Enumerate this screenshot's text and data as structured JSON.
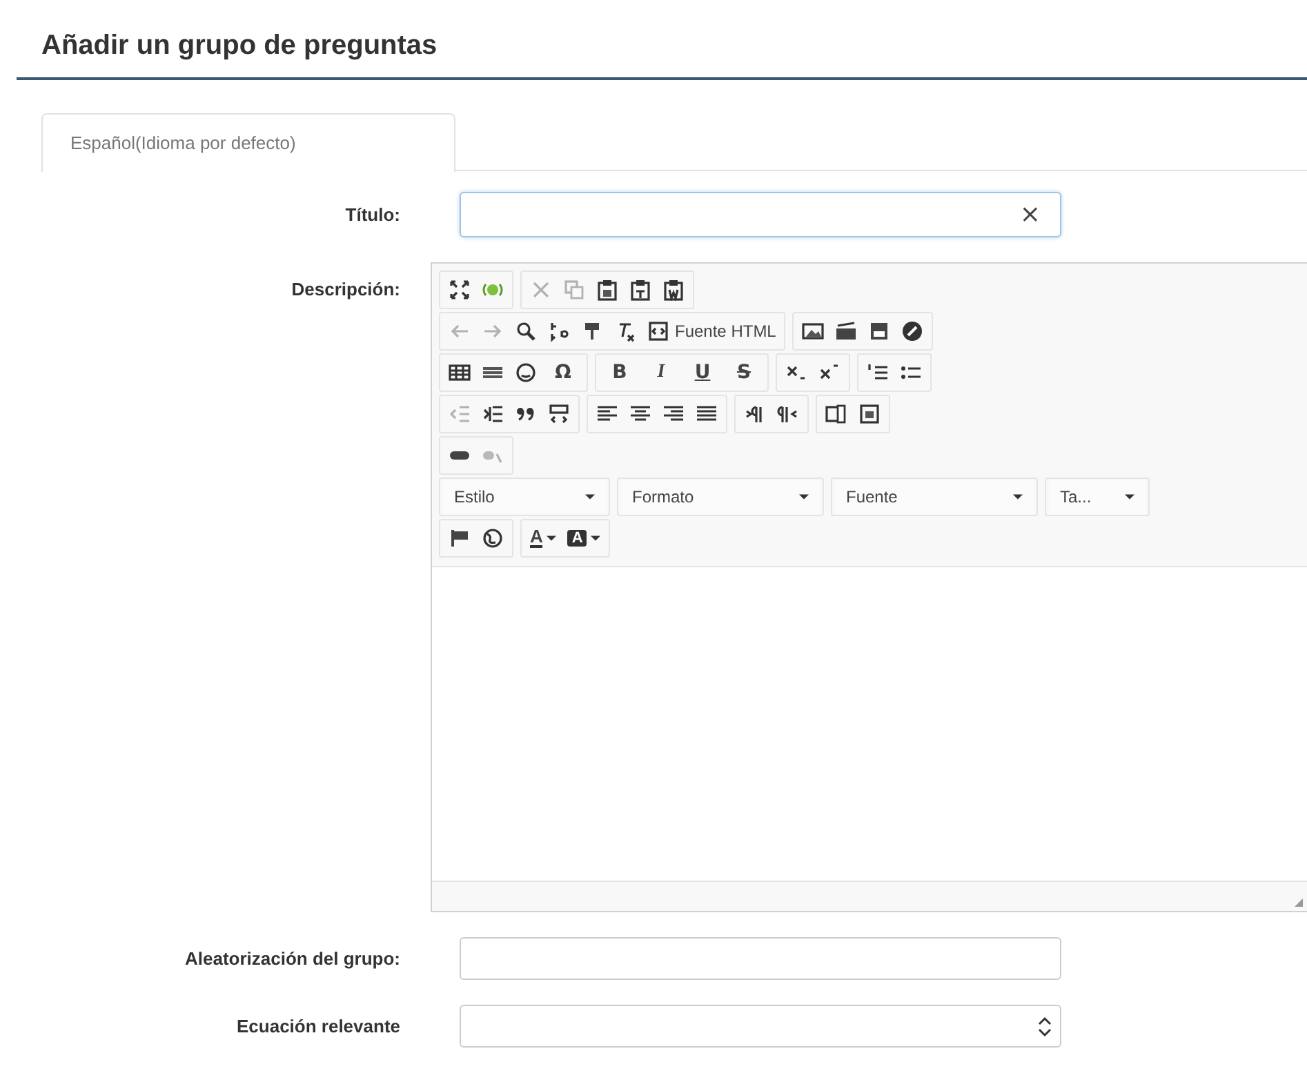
{
  "page_title": "Añadir un grupo de preguntas",
  "tabs": [
    {
      "label": "Español(Idioma por defecto)",
      "selected": true
    }
  ],
  "title_field": {
    "label": "Título:",
    "clear_button": "×"
  },
  "description": {
    "label": "Descripción:",
    "toolbar_rows": [
      {
        "groups": [
          {
            "items": [
              {
                "kind": "icon",
                "disabled": false
              },
              {
                "kind": "icon",
                "disabled": false
              }
            ]
          },
          {
            "items": [
              {
                "kind": "icon",
                "disabled": true
              },
              {
                "kind": "icon",
                "disabled": true
              },
              {
                "kind": "icon",
                "disabled": false
              },
              {
                "kind": "icon",
                "disabled": false
              },
              {
                "kind": "icon",
                "disabled": false
              }
            ]
          }
        ]
      },
      {
        "groups": [
          {
            "items": [
              {
                "kind": "icon",
                "disabled": true
              },
              {
                "kind": "icon",
                "disabled": true
              },
              {
                "kind": "icon",
                "disabled": false
              },
              {
                "kind": "icon",
                "disabled": false
              },
              {
                "kind": "icon",
                "disabled": false
              },
              {
                "kind": "icon",
                "disabled": false
              },
              {
                "kind": "button",
                "label": "Fuente HTML",
                "disabled": false
              }
            ]
          },
          {
            "items": [
              {
                "kind": "icon",
                "disabled": false
              },
              {
                "kind": "icon",
                "disabled": false
              },
              {
                "kind": "icon",
                "disabled": false
              },
              {
                "kind": "icon",
                "disabled": false
              }
            ]
          }
        ]
      },
      {
        "groups": [
          {
            "items": [
              {
                "kind": "icon",
                "disabled": false
              },
              {
                "kind": "icon",
                "disabled": false
              },
              {
                "kind": "icon",
                "disabled": false
              },
              {
                "kind": "glyph",
                "text": "Ω",
                "disabled": false
              }
            ]
          },
          {
            "items": [
              {
                "kind": "glyph",
                "text": "B",
                "disabled": false
              },
              {
                "kind": "glyph",
                "text": "I",
                "disabled": false
              },
              {
                "kind": "glyph",
                "text": "U",
                "disabled": false
              },
              {
                "kind": "glyph",
                "text": "S",
                "disabled": false
              }
            ]
          },
          {
            "items": [
              {
                "kind": "icon",
                "disabled": false
              },
              {
                "kind": "icon",
                "disabled": false
              }
            ]
          },
          {
            "items": [
              {
                "kind": "icon",
                "disabled": false
              },
              {
                "kind": "icon",
                "disabled": false
              }
            ]
          }
        ]
      },
      {
        "groups": [
          {
            "items": [
              {
                "kind": "icon",
                "disabled": true
              },
              {
                "kind": "icon",
                "disabled": false
              },
              {
                "kind": "icon",
                "disabled": false
              },
              {
                "kind": "icon",
                "disabled": false
              }
            ]
          },
          {
            "items": [
              {
                "kind": "icon",
                "disabled": false
              },
              {
                "kind": "icon",
                "disabled": false
              },
              {
                "kind": "icon",
                "disabled": false
              },
              {
                "kind": "icon",
                "disabled": false
              }
            ]
          },
          {
            "items": [
              {
                "kind": "icon",
                "disabled": false
              },
              {
                "kind": "icon",
                "disabled": false
              }
            ]
          },
          {
            "items": [
              {
                "kind": "icon",
                "disabled": false
              },
              {
                "kind": "icon",
                "disabled": false
              }
            ]
          }
        ]
      },
      {
        "groups": [
          {
            "items": [
              {
                "kind": "icon",
                "disabled": false
              },
              {
                "kind": "icon",
                "disabled": true
              }
            ]
          }
        ]
      },
      {
        "groups": [
          {
            "items": [
              {
                "kind": "dropdown",
                "label": "Estilo",
                "disabled": false
              }
            ]
          },
          {
            "items": [
              {
                "kind": "dropdown",
                "label": "Formato",
                "disabled": false
              }
            ]
          },
          {
            "items": [
              {
                "kind": "dropdown",
                "label": "Fuente",
                "disabled": false
              }
            ]
          },
          {
            "items": [
              {
                "kind": "dropdown",
                "label": "Ta...",
                "disabled": false
              }
            ]
          }
        ]
      },
      {
        "groups": [
          {
            "items": [
              {
                "kind": "icon",
                "disabled": false
              },
              {
                "kind": "icon",
                "disabled": false
              }
            ]
          },
          {
            "items": [
              {
                "kind": "text-color",
                "text": "A",
                "disabled": false
              },
              {
                "kind": "bg-color",
                "text": "A",
                "disabled": false
              }
            ]
          }
        ]
      }
    ]
  },
  "randomization_field": {
    "label": "Aleatorización del grupo:"
  },
  "relevance_field": {
    "label": "Ecuación relevante"
  }
}
